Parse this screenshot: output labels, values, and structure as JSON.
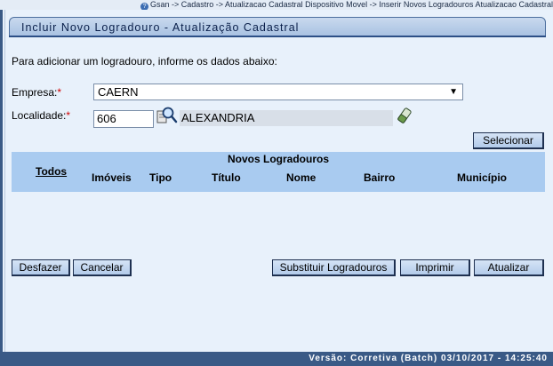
{
  "breadcrumb": {
    "text": "Gsan -> Cadastro -> Atualizacao Cadastral Dispositivo Movel -> Inserir Novos Logradouros Atualizacao Cadastral"
  },
  "page": {
    "title": "Incluir Novo Logradouro - Atualização Cadastral",
    "intro": "Para adicionar um logradouro, informe os dados abaixo:"
  },
  "form": {
    "empresa_label": "Empresa:",
    "empresa_value": "CAERN",
    "localidade_label": "Localidade:",
    "localidade_code": "606",
    "localidade_name": "ALEXANDRIA",
    "required_mark": "*"
  },
  "buttons": {
    "selecionar": "Selecionar",
    "desfazer": "Desfazer",
    "cancelar": "Cancelar",
    "substituir": "Substituir Logradouros",
    "imprimir": "Imprimir",
    "atualizar": "Atualizar"
  },
  "grid": {
    "title": "Novos Logradouros",
    "columns": {
      "todos": "Todos",
      "imoveis": "Imóveis",
      "tipo": "Tipo",
      "titulo": "Título",
      "nome": "Nome",
      "bairro": "Bairro",
      "municipio": "Município"
    }
  },
  "footer": {
    "version": "Versão: Corretiva (Batch) 03/10/2017 - 14:25:40"
  },
  "icons": {
    "lookup": "magnifier-lookup-icon",
    "erase": "eraser-icon",
    "help": "help-icon"
  },
  "colors": {
    "background": "#e8f1fb",
    "grid_header": "#a9cbf0",
    "footer": "#3a5a86",
    "required": "#d00000"
  }
}
